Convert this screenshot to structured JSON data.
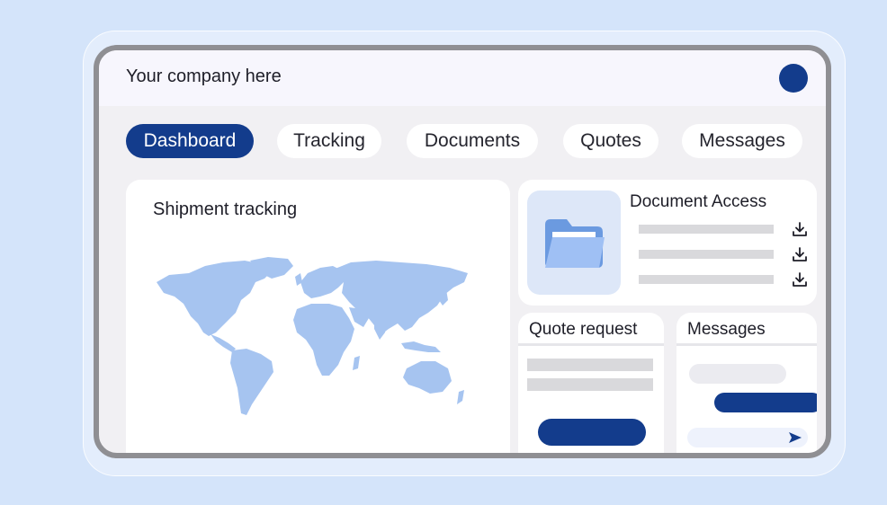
{
  "header": {
    "company": "Your company here"
  },
  "tabs": [
    {
      "label": "Dashboard",
      "active": true
    },
    {
      "label": "Tracking",
      "active": false
    },
    {
      "label": "Documents",
      "active": false
    },
    {
      "label": "Quotes",
      "active": false
    },
    {
      "label": "Messages",
      "active": false
    }
  ],
  "shipment": {
    "title": "Shipment tracking",
    "map_icon": "world-map"
  },
  "documents": {
    "title": "Document Access",
    "icon": "folder-icon",
    "download_icon": "download-icon"
  },
  "quote": {
    "title": "Quote request"
  },
  "messages": {
    "title": "Messages",
    "send_icon": "send-icon"
  },
  "colors": {
    "accent": "#133c8c",
    "background": "#d4e4fa",
    "map": "#a6c4f0",
    "folder": "#6b9ae0"
  }
}
